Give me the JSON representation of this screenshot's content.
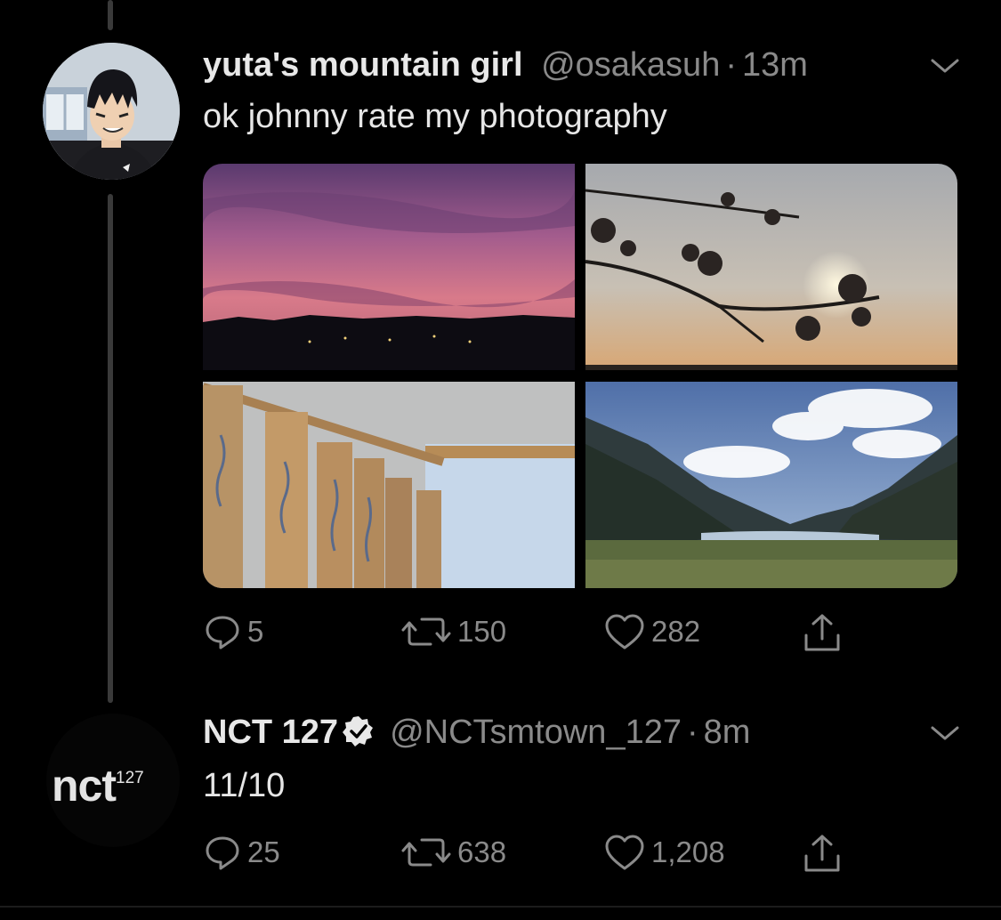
{
  "tweets": [
    {
      "name": "yuta's mountain girl",
      "handle": "@osakasuh",
      "dot": "·",
      "time": "13m",
      "text": "ok johnny rate my photography",
      "replies": "5",
      "retweets": "150",
      "likes": "282",
      "avatar_icon": "anime-avatar",
      "photos": [
        "sunset-photo",
        "cherry-blossom-photo",
        "wind-chime-photo",
        "mountain-lake-photo"
      ]
    },
    {
      "name": "NCT 127",
      "handle": "@NCTsmtown_127",
      "dot": "·",
      "time": "8m",
      "text": "11/10",
      "replies": "25",
      "retweets": "638",
      "likes": "1,208",
      "avatar_logo": {
        "main": "nct",
        "sup": "127"
      },
      "verified_icon": "verified-badge-icon"
    }
  ],
  "colors": {
    "background": "#000000",
    "muted": "#8a8a8a",
    "text": "#e6e6e6"
  }
}
